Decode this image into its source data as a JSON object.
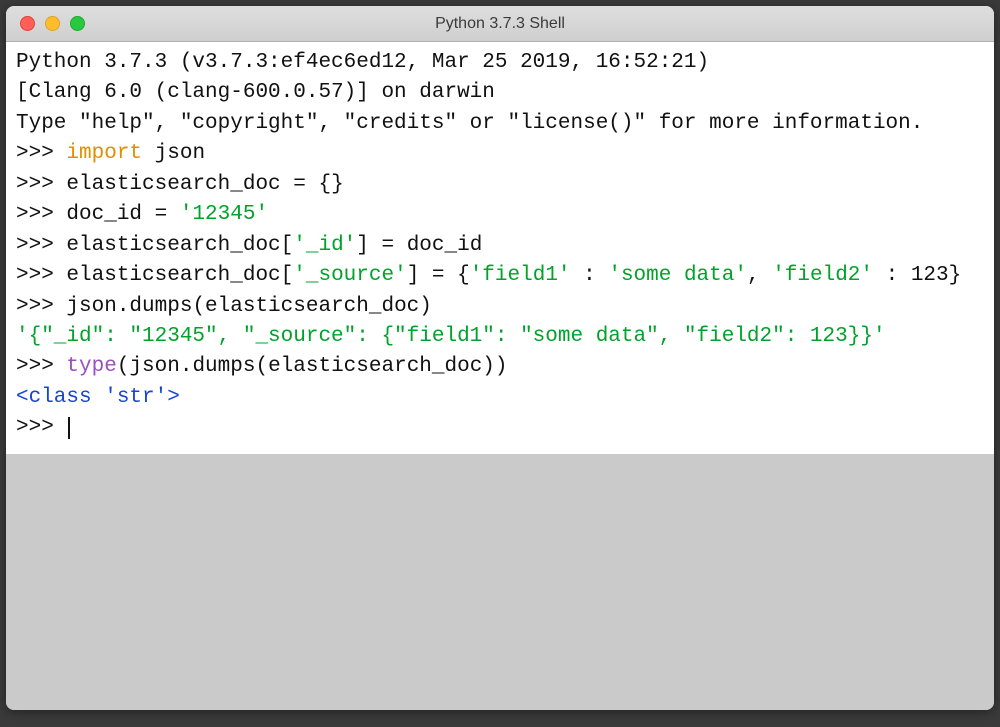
{
  "window": {
    "title": "Python 3.7.3 Shell"
  },
  "banner": {
    "line1": "Python 3.7.3 (v3.7.3:ef4ec6ed12, Mar 25 2019, 16:52:21) ",
    "line2": "[Clang 6.0 (clang-600.0.57)] on darwin",
    "line3": "Type \"help\", \"copyright\", \"credits\" or \"license()\" for more information."
  },
  "repl": {
    "prompt": ">>> ",
    "lines": [
      {
        "type": "input",
        "segments": [
          {
            "cls": "syn-keyword",
            "text": "import"
          },
          {
            "cls": "",
            "text": " json"
          }
        ]
      },
      {
        "type": "input",
        "segments": [
          {
            "cls": "",
            "text": "elasticsearch_doc = {}"
          }
        ]
      },
      {
        "type": "input",
        "segments": [
          {
            "cls": "",
            "text": "doc_id = "
          },
          {
            "cls": "syn-string",
            "text": "'12345'"
          }
        ]
      },
      {
        "type": "input",
        "segments": [
          {
            "cls": "",
            "text": "elasticsearch_doc["
          },
          {
            "cls": "syn-string",
            "text": "'_id'"
          },
          {
            "cls": "",
            "text": "] = doc_id"
          }
        ]
      },
      {
        "type": "input",
        "segments": [
          {
            "cls": "",
            "text": "elasticsearch_doc["
          },
          {
            "cls": "syn-string",
            "text": "'_source'"
          },
          {
            "cls": "",
            "text": "] = {"
          },
          {
            "cls": "syn-string",
            "text": "'field1'"
          },
          {
            "cls": "",
            "text": " : "
          },
          {
            "cls": "syn-string",
            "text": "'some data'"
          },
          {
            "cls": "",
            "text": ", "
          },
          {
            "cls": "syn-string",
            "text": "'field2'"
          },
          {
            "cls": "",
            "text": " : 123}"
          }
        ]
      },
      {
        "type": "input",
        "segments": [
          {
            "cls": "",
            "text": "json.dumps(elasticsearch_doc)"
          }
        ]
      },
      {
        "type": "output",
        "segments": [
          {
            "cls": "syn-output-str",
            "text": "'{\"_id\": \"12345\", \"_source\": {\"field1\": \"some data\", \"field2\": 123}}'"
          }
        ]
      },
      {
        "type": "input",
        "segments": [
          {
            "cls": "syn-builtin",
            "text": "type"
          },
          {
            "cls": "",
            "text": "(json.dumps(elasticsearch_doc))"
          }
        ]
      },
      {
        "type": "output",
        "segments": [
          {
            "cls": "syn-class",
            "text": "<class 'str'>"
          }
        ]
      },
      {
        "type": "input-cursor",
        "segments": []
      }
    ]
  }
}
